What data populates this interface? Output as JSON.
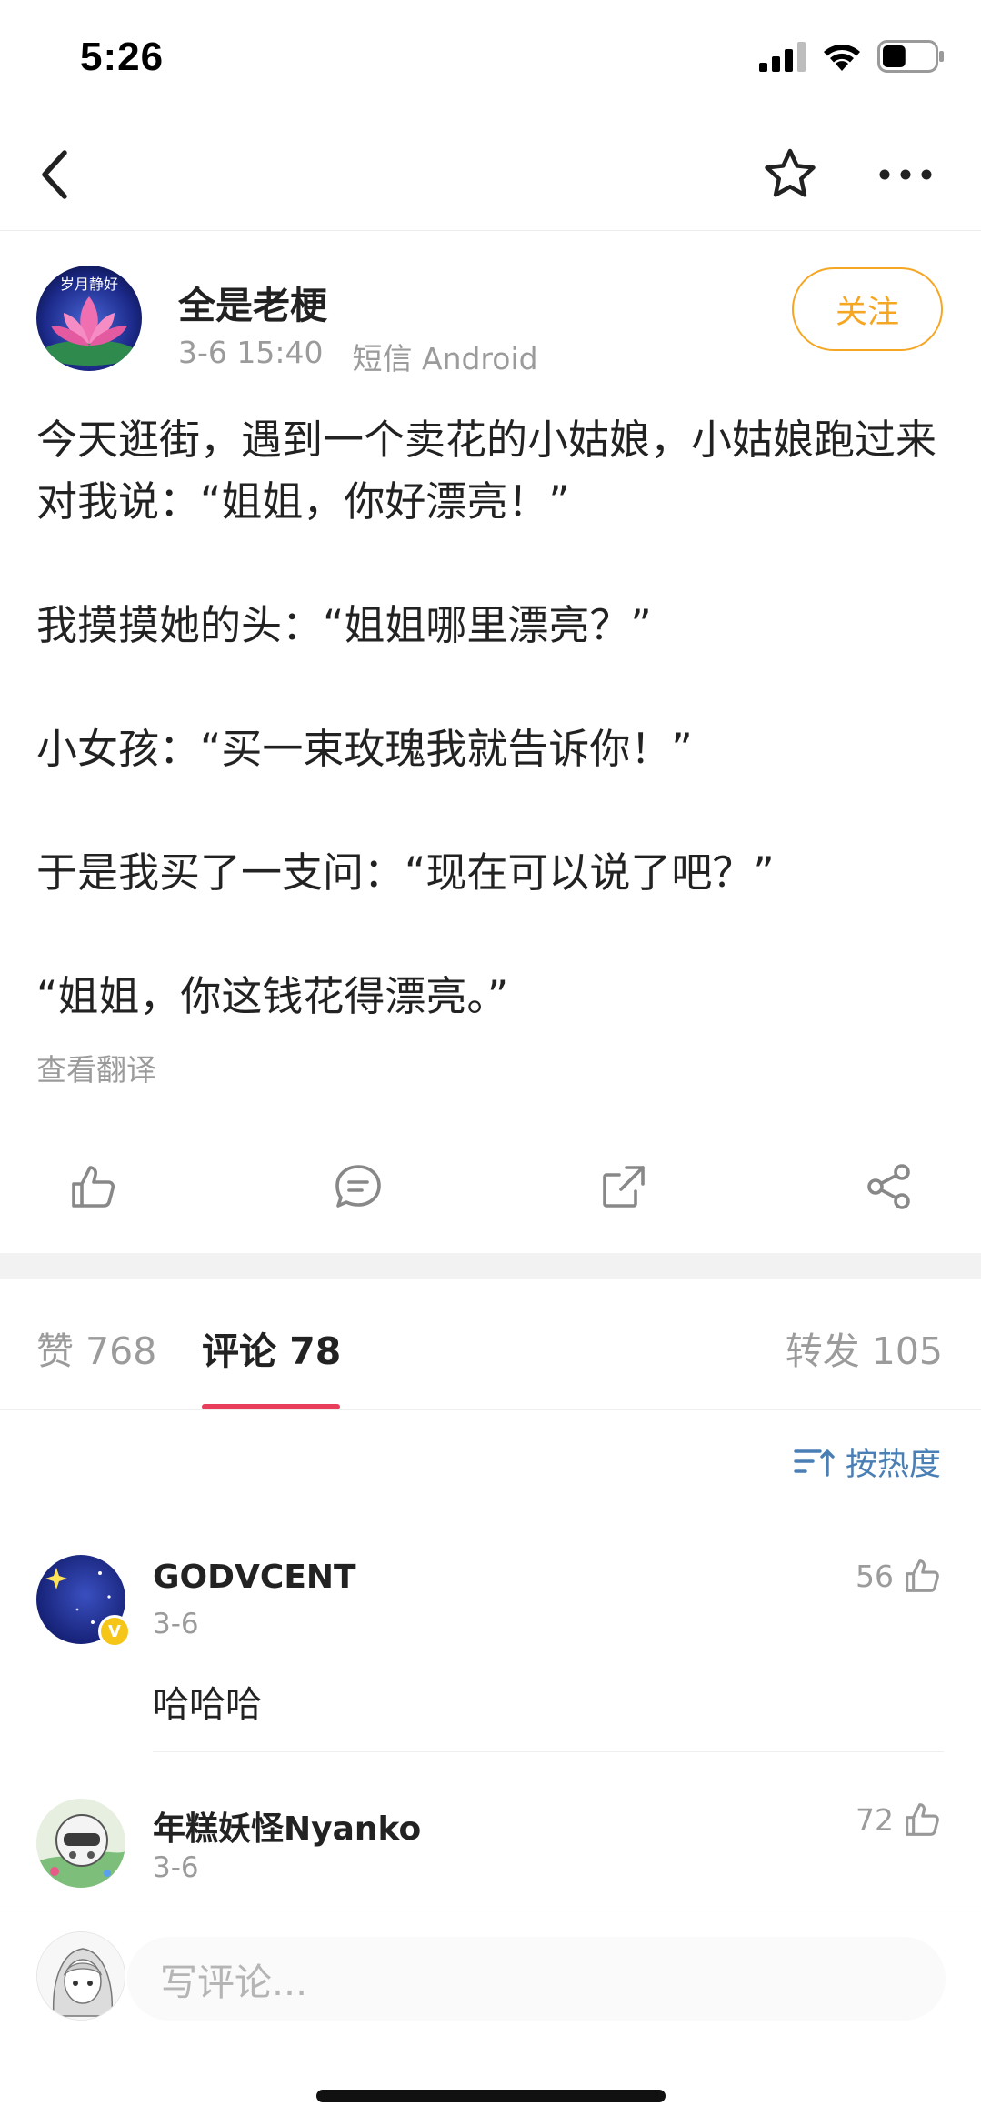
{
  "status_bar": {
    "time": "5:26",
    "battery_level": 0.45
  },
  "nav": {
    "back_icon": "chevron-left-icon",
    "favorite_icon": "star-icon",
    "more_icon": "more-dots-icon"
  },
  "post": {
    "avatar_text": "岁月静好",
    "author": "全是老梗",
    "date": "3-6 15:40",
    "source": "短信 Android",
    "follow_label": "关注",
    "lines": [
      "今天逛街，遇到一个卖花的小姑娘，小姑娘跑过来对我说：“姐姐，你好漂亮！”",
      "我摸摸她的头：“姐姐哪里漂亮？”",
      "小女孩：“买一束玫瑰我就告诉你！”",
      "于是我买了一支问：“现在可以说了吧？”",
      "“姐姐，你这钱花得漂亮。”"
    ],
    "translate_label": "查看翻译"
  },
  "tabs": {
    "likes": "赞 768",
    "comments": "评论 78",
    "reposts": "转发 105"
  },
  "sort_label": "按热度",
  "comments": [
    {
      "name": "GODVCENT",
      "date": "3-6",
      "likes": "56",
      "text": "哈哈哈",
      "verified_badge": "V"
    },
    {
      "name": "年糕妖怪Nyanko",
      "date": "3-6",
      "likes": "72",
      "text": ""
    }
  ],
  "composer": {
    "placeholder": "写评论..."
  },
  "colors": {
    "accent_orange": "#f5a623",
    "tab_underline": "#e83e5c",
    "link_blue": "#4a7fb5",
    "verified_yellow": "#f5c518"
  }
}
